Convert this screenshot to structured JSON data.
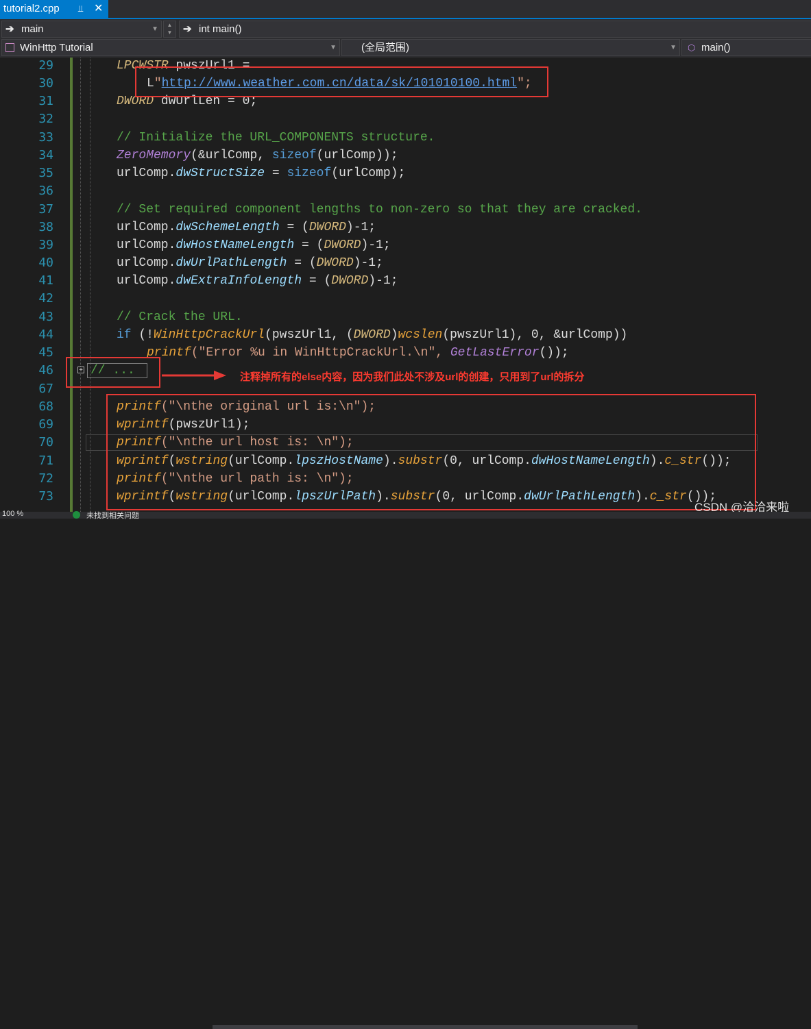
{
  "tab": {
    "title": "tutorial2.cpp",
    "pin_icon": "pin-icon",
    "close_icon": "close-icon"
  },
  "nav1": {
    "scope": "main",
    "member": "int main()"
  },
  "nav2": {
    "project": "WinHttp Tutorial",
    "scope": "(全局范围)",
    "member": "main()"
  },
  "line_numbers": [
    "29",
    "30",
    "31",
    "32",
    "33",
    "34",
    "35",
    "36",
    "37",
    "38",
    "39",
    "40",
    "41",
    "42",
    "43",
    "44",
    "45",
    "46",
    "67",
    "68",
    "69",
    "70",
    "71",
    "72",
    "73"
  ],
  "code": {
    "l29": [
      "LPCWSTR",
      " pwszUrl1 ="
    ],
    "l30": [
      "L",
      "\"",
      "http://www.weather.com.cn/data/sk/101010100.html",
      "\";"
    ],
    "l31": [
      "DWORD",
      " dwUrlLen = 0;"
    ],
    "l33": "// Initialize the URL_COMPONENTS structure.",
    "l34": [
      "ZeroMemory",
      "(&urlComp, ",
      "sizeof",
      "(urlComp));"
    ],
    "l35": [
      "urlComp.",
      "dwStructSize",
      " = ",
      "sizeof",
      "(urlComp);"
    ],
    "l37": "// Set required component lengths to non-zero so that they are cracked.",
    "l38": [
      "urlComp.",
      "dwSchemeLength",
      " = (",
      "DWORD",
      ")-1;"
    ],
    "l39": [
      "urlComp.",
      "dwHostNameLength",
      " = (",
      "DWORD",
      ")-1;"
    ],
    "l40": [
      "urlComp.",
      "dwUrlPathLength",
      " = (",
      "DWORD",
      ")-1;"
    ],
    "l41": [
      "urlComp.",
      "dwExtraInfoLength",
      " = (",
      "DWORD",
      ")-1;"
    ],
    "l43": "// Crack the URL.",
    "l44": [
      "if",
      " (!",
      "WinHttpCrackUrl",
      "(pwszUrl1, (",
      "DWORD",
      ")",
      "wcslen",
      "(pwszUrl1), 0, &urlComp))"
    ],
    "l45": [
      "printf",
      "(\"Error %u in WinHttpCrackUrl.\\n\", ",
      "GetLastError",
      "());"
    ],
    "l46": "// ...",
    "l68": [
      "printf",
      "(\"\\nthe original url is:\\n\");"
    ],
    "l69": [
      "wprintf",
      "(pwszUrl1);"
    ],
    "l70": [
      "printf",
      "(\"\\nthe url host is: \\n\");"
    ],
    "l71": [
      "wprintf",
      "(",
      "wstring",
      "(urlComp.",
      "lpszHostName",
      ").",
      "substr",
      "(0, urlComp.",
      "dwHostNameLength",
      ").",
      "c_str",
      "());"
    ],
    "l72": [
      "printf",
      "(\"\\nthe url path is: \\n\");"
    ],
    "l73": [
      "wprintf",
      "(",
      "wstring",
      "(urlComp.",
      "lpszUrlPath",
      ").",
      "substr",
      "(0, urlComp.",
      "dwUrlPathLength",
      ").",
      "c_str",
      "());"
    ]
  },
  "annotation": "注释掉所有的else内容，因为我们此处不涉及url的创建，只用到了url的拆分",
  "watermark": "CSDN @洽洽来啦",
  "status": {
    "zoom": "100 %",
    "issues": "未找到相关问题"
  },
  "colors": {
    "accent": "#007acc",
    "annotation": "#e53935",
    "change_bar": "#577a35"
  }
}
